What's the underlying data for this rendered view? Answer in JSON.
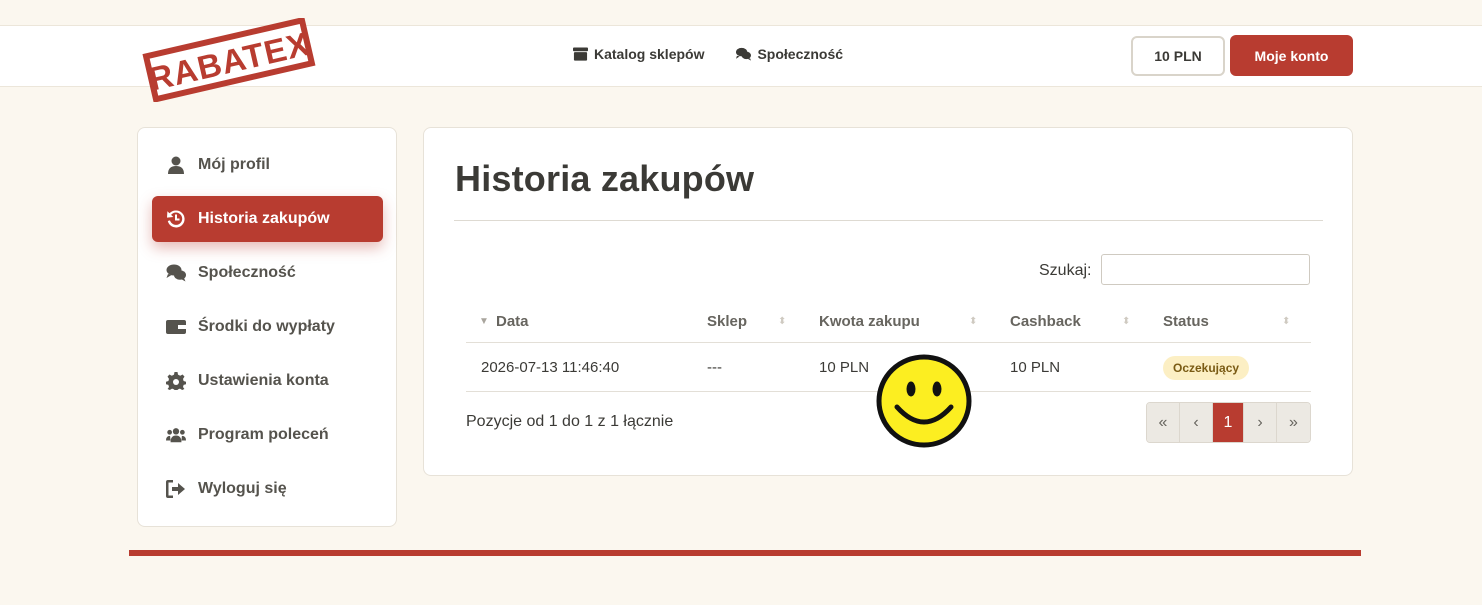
{
  "brand": {
    "logo_text": "RABATEX",
    "accent": "#b83c30"
  },
  "nav": {
    "catalog": {
      "label": "Katalog sklepów",
      "icon": "store-icon"
    },
    "community": {
      "label": "Społeczność",
      "icon": "comments-icon"
    }
  },
  "header": {
    "balance": "10 PLN",
    "account_label": "Moje konto"
  },
  "sidebar": {
    "items": [
      {
        "label": "Mój profil",
        "icon": "user-icon"
      },
      {
        "label": "Historia zakupów",
        "icon": "history-icon",
        "active": true
      },
      {
        "label": "Społeczność",
        "icon": "comments-icon"
      },
      {
        "label": "Środki do wypłaty",
        "icon": "wallet-icon"
      },
      {
        "label": "Ustawienia konta",
        "icon": "gear-icon"
      },
      {
        "label": "Program poleceń",
        "icon": "users-icon"
      },
      {
        "label": "Wyloguj się",
        "icon": "logout-icon"
      }
    ]
  },
  "main": {
    "title": "Historia zakupów",
    "search_label": "Szukaj:",
    "search_value": "",
    "table": {
      "columns": [
        "Data",
        "Sklep",
        "Kwota zakupu",
        "Cashback",
        "Status"
      ],
      "rows": [
        {
          "data": "2026-07-13 11:46:40",
          "sklep": "---",
          "kwota": "10 PLN",
          "cashback": "10 PLN",
          "status": "Oczekujący"
        }
      ]
    },
    "info": "Pozycje od 1 do 1 z 1 łącznie",
    "pagination": {
      "first": "«",
      "prev": "‹",
      "current": "1",
      "next": "›",
      "last": "»"
    }
  }
}
